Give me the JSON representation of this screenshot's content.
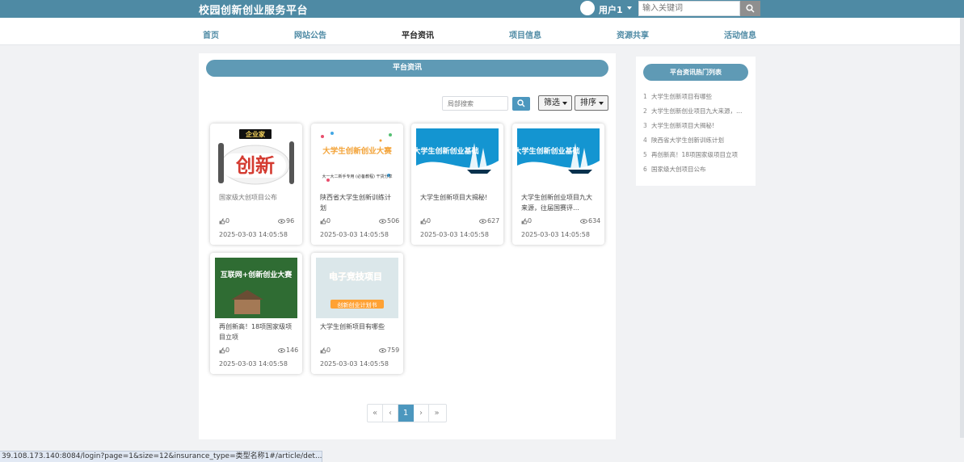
{
  "app": {
    "title": "校园创新创业服务平台"
  },
  "user": {
    "name": "用户1"
  },
  "search": {
    "placeholder": "输入关键词"
  },
  "nav": {
    "items": [
      {
        "label": "首页"
      },
      {
        "label": "网站公告"
      },
      {
        "label": "平台资讯",
        "active": true
      },
      {
        "label": "项目信息"
      },
      {
        "label": "资源共享"
      },
      {
        "label": "活动信息"
      }
    ]
  },
  "main": {
    "section_title": "平台资讯",
    "local_search_placeholder": "局部搜索",
    "filter_label": "筛选",
    "sort_label": "排序",
    "cards": [
      {
        "title": "国家级大创项目公布",
        "likes": "0",
        "views": "96",
        "date": "2025-03-03 14:05:58",
        "image": "创新",
        "image_badge": "企业家",
        "muted": true
      },
      {
        "title": "陕西省大学生创新训练计划",
        "likes": "0",
        "views": "506",
        "date": "2025-03-03 14:05:58",
        "image": "大学生创新创业大赛",
        "image_caption": "大一大二新手专用 (必备教程) 干货分享"
      },
      {
        "title": "大学生创新项目大揭秘!",
        "likes": "0",
        "views": "627",
        "date": "2025-03-03 14:05:58",
        "image": "大学生创新创业基础"
      },
      {
        "title": "大学生创新创业项目九大来源，往届国赛评…",
        "likes": "0",
        "views": "634",
        "date": "2025-03-03 14:05:58",
        "image": "大学生创新创业基础"
      },
      {
        "title": "再创新高！18项国家级项目立项",
        "likes": "0",
        "views": "146",
        "date": "2025-03-03 14:05:58",
        "image": "互联网+创新创业大赛"
      },
      {
        "title": "大学生创新项目有哪些",
        "likes": "0",
        "views": "759",
        "date": "2025-03-03 14:05:58",
        "image": "电子竞技项目",
        "image_caption": "创新创业计划书"
      }
    ],
    "pager": {
      "first": "«",
      "prev": "‹",
      "current": "1",
      "next": "›",
      "last": "»"
    }
  },
  "sidebar": {
    "title": "平台资讯热门列表",
    "items": [
      {
        "num": "1",
        "text": "大学生创新项目有哪些"
      },
      {
        "num": "2",
        "text": "大学生创新创业项目九大来源，往届国赛评…"
      },
      {
        "num": "3",
        "text": "大学生创新项目大揭秘!"
      },
      {
        "num": "4",
        "text": "陕西省大学生创新训练计划"
      },
      {
        "num": "5",
        "text": "再创新高！18项国家级项目立项"
      },
      {
        "num": "6",
        "text": "国家级大创项目公布"
      }
    ]
  },
  "status_bar": {
    "url": "39.108.173.140:8084/login?page=1&size=12&insurance_type=类型名称1#/article/det..."
  }
}
